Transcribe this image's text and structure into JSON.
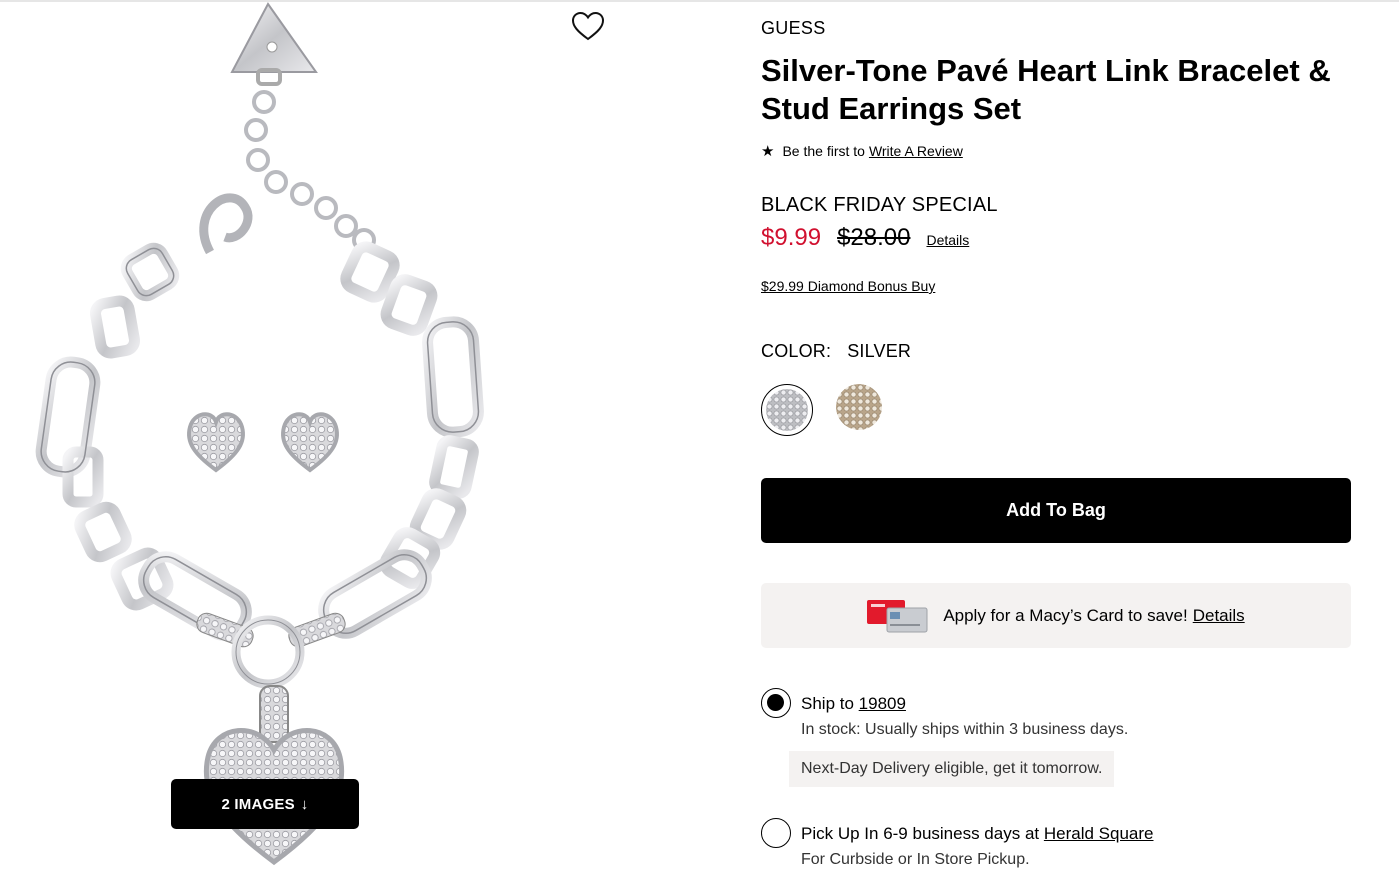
{
  "gallery": {
    "images_button_label": "2 IMAGES",
    "images_button_arrow": "↓"
  },
  "product": {
    "brand": "GUESS",
    "title": "Silver-Tone Pavé Heart Link Bracelet & Stud Earrings Set",
    "review_prompt": "Be the first to",
    "review_link": "Write A Review",
    "promo_label": "BLACK FRIDAY SPECIAL",
    "sale_price": "$9.99",
    "original_price": "$28.00",
    "price_details_link": "Details",
    "bonus_buy_link": "$29.99 Diamond Bonus Buy",
    "color_label": "COLOR:",
    "color_value": "SILVER",
    "swatches": [
      {
        "name": "Silver",
        "color": "#c9c9cb",
        "selected": true
      },
      {
        "name": "Gold",
        "color": "#c7b8a1",
        "selected": false
      }
    ],
    "add_to_bag_label": "Add To Bag"
  },
  "card_offer": {
    "text": "Apply for a Macy’s Card to save!",
    "link": "Details"
  },
  "shipping": {
    "ship_label": "Ship to",
    "zip": "19809",
    "ship_selected": true,
    "stock_text": "In stock: Usually ships within 3 business days.",
    "next_day_text": "Next-Day Delivery eligible, get it tomorrow.",
    "pickup_label": "Pick Up In 6-9 business days",
    "pickup_at": "at",
    "pickup_store": "Herald Square",
    "pickup_sub": "For Curbside or In Store Pickup."
  },
  "colors": {
    "sale_red": "#d1102f",
    "button_black": "#000000",
    "banner_bg": "#f4f2f1"
  }
}
